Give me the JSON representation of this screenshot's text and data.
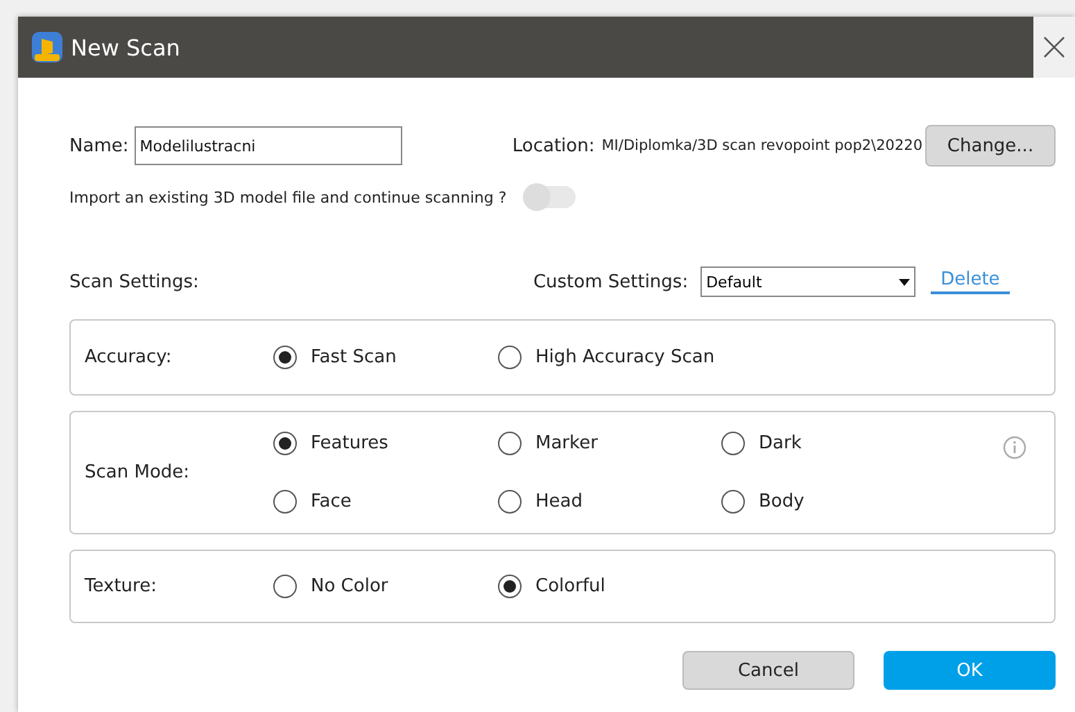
{
  "window": {
    "title": "New Scan"
  },
  "name": {
    "label": "Name:",
    "value": "Modelilustracni"
  },
  "location": {
    "label": "Location:",
    "path": "MI/Diplomka/3D scan revopoint pop2\\20220",
    "button": "Change..."
  },
  "import_toggle": {
    "label": "Import an existing 3D model file and continue scanning ?",
    "on": false
  },
  "scan_settings": {
    "label": "Scan Settings:"
  },
  "custom_settings": {
    "label": "Custom Settings:",
    "value": "Default",
    "delete": "Delete"
  },
  "groups": [
    {
      "label": "Accuracy:",
      "info": false,
      "options": [
        {
          "label": "Fast Scan",
          "selected": true
        },
        {
          "label": "High Accuracy Scan",
          "selected": false
        }
      ]
    },
    {
      "label": "Scan Mode:",
      "info": true,
      "options": [
        {
          "label": "Features",
          "selected": true
        },
        {
          "label": "Marker",
          "selected": false
        },
        {
          "label": "Dark",
          "selected": false
        },
        {
          "label": "Face",
          "selected": false
        },
        {
          "label": "Head",
          "selected": false
        },
        {
          "label": "Body",
          "selected": false
        }
      ]
    },
    {
      "label": "Texture:",
      "info": false,
      "options": [
        {
          "label": "No Color",
          "selected": false
        },
        {
          "label": "Colorful",
          "selected": true
        }
      ]
    }
  ],
  "buttons": {
    "cancel": "Cancel",
    "ok": "OK"
  }
}
